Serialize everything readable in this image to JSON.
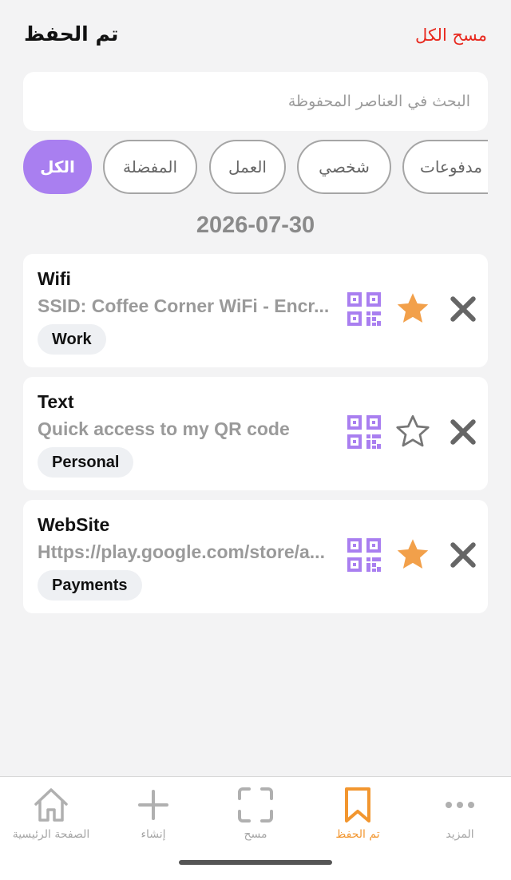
{
  "header": {
    "title": "تم الحفظ",
    "clear_label": "مسح الكل"
  },
  "search": {
    "placeholder": "البحث في العناصر المحفوظة",
    "value": ""
  },
  "filters": [
    {
      "label": "الكل",
      "active": true
    },
    {
      "label": "المفضلة",
      "active": false
    },
    {
      "label": "العمل",
      "active": false
    },
    {
      "label": "شخصي",
      "active": false
    },
    {
      "label": "مدفوعات",
      "active": false
    }
  ],
  "date_header": "2026-07-30",
  "items": [
    {
      "title": "Wifi",
      "subtitle": "SSID: Coffee Corner WiFi - Encr...",
      "tag": "Work",
      "favorite": true
    },
    {
      "title": "Text",
      "subtitle": "Quick access to my QR code",
      "tag": "Personal",
      "favorite": false
    },
    {
      "title": "WebSite",
      "subtitle": "Https://play.google.com/store/a...",
      "tag": "Payments",
      "favorite": true
    }
  ],
  "tabbar": {
    "home": "الصفحة الرئيسية",
    "create": "إنشاء",
    "scan": "مسح",
    "saved": "تم الحفظ",
    "more": "المزيد"
  },
  "colors": {
    "accent_purple": "#a97ff0",
    "star_orange": "#f2a04a",
    "active_tab": "#f2962f",
    "clear_red": "#e8291f",
    "icon_gray": "#666666"
  }
}
